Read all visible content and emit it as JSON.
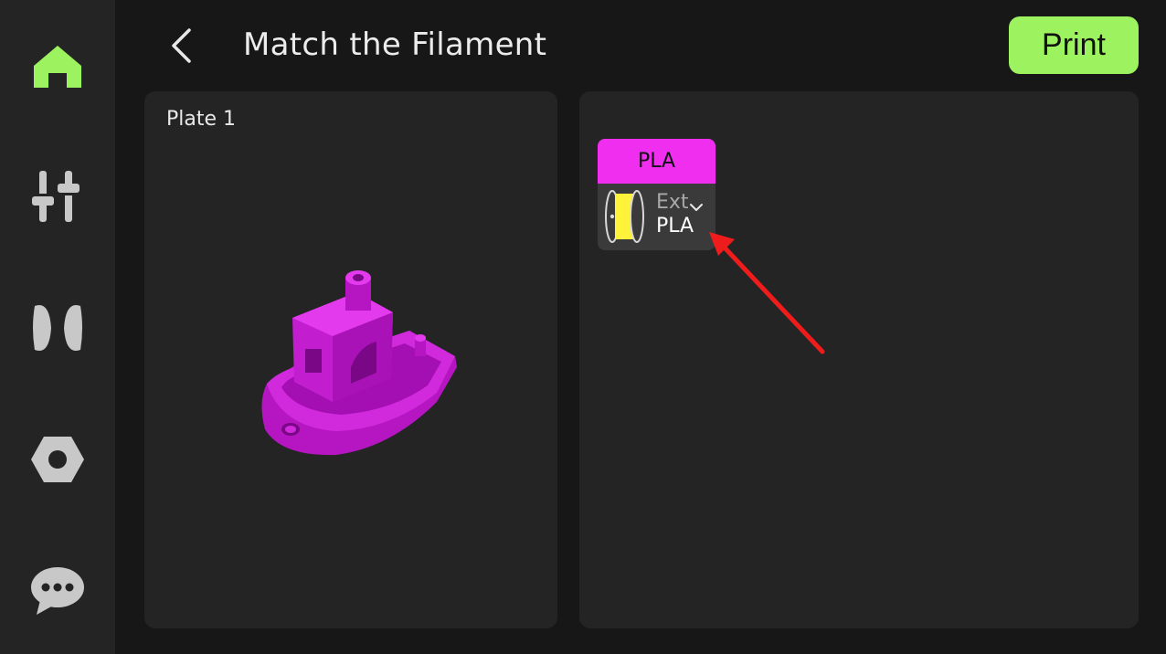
{
  "sidebar": {
    "items": [
      {
        "name": "home",
        "icon": "home-icon",
        "active": true
      },
      {
        "name": "controls",
        "icon": "sliders-icon",
        "active": false
      },
      {
        "name": "filament",
        "icon": "spool-icon",
        "active": false
      },
      {
        "name": "settings",
        "icon": "hex-nut-icon",
        "active": false
      },
      {
        "name": "messages",
        "icon": "chat-bubble-icon",
        "active": false
      }
    ]
  },
  "header": {
    "back_icon": "chevron-left-icon",
    "title": "Match the Filament",
    "print_label": "Print"
  },
  "plate": {
    "label": "Plate 1",
    "model": "boat-model"
  },
  "filament_slot": {
    "required_material": "PLA",
    "required_color": "#ef2ef0",
    "source_label": "Ext",
    "selected_material": "PLA",
    "spool_color": "#fff23a",
    "dropdown_icon": "chevron-down-icon"
  },
  "colors": {
    "accent": "#9df25f",
    "background": "#171717",
    "panel": "#242424",
    "annotation": "#ef1c1c"
  }
}
